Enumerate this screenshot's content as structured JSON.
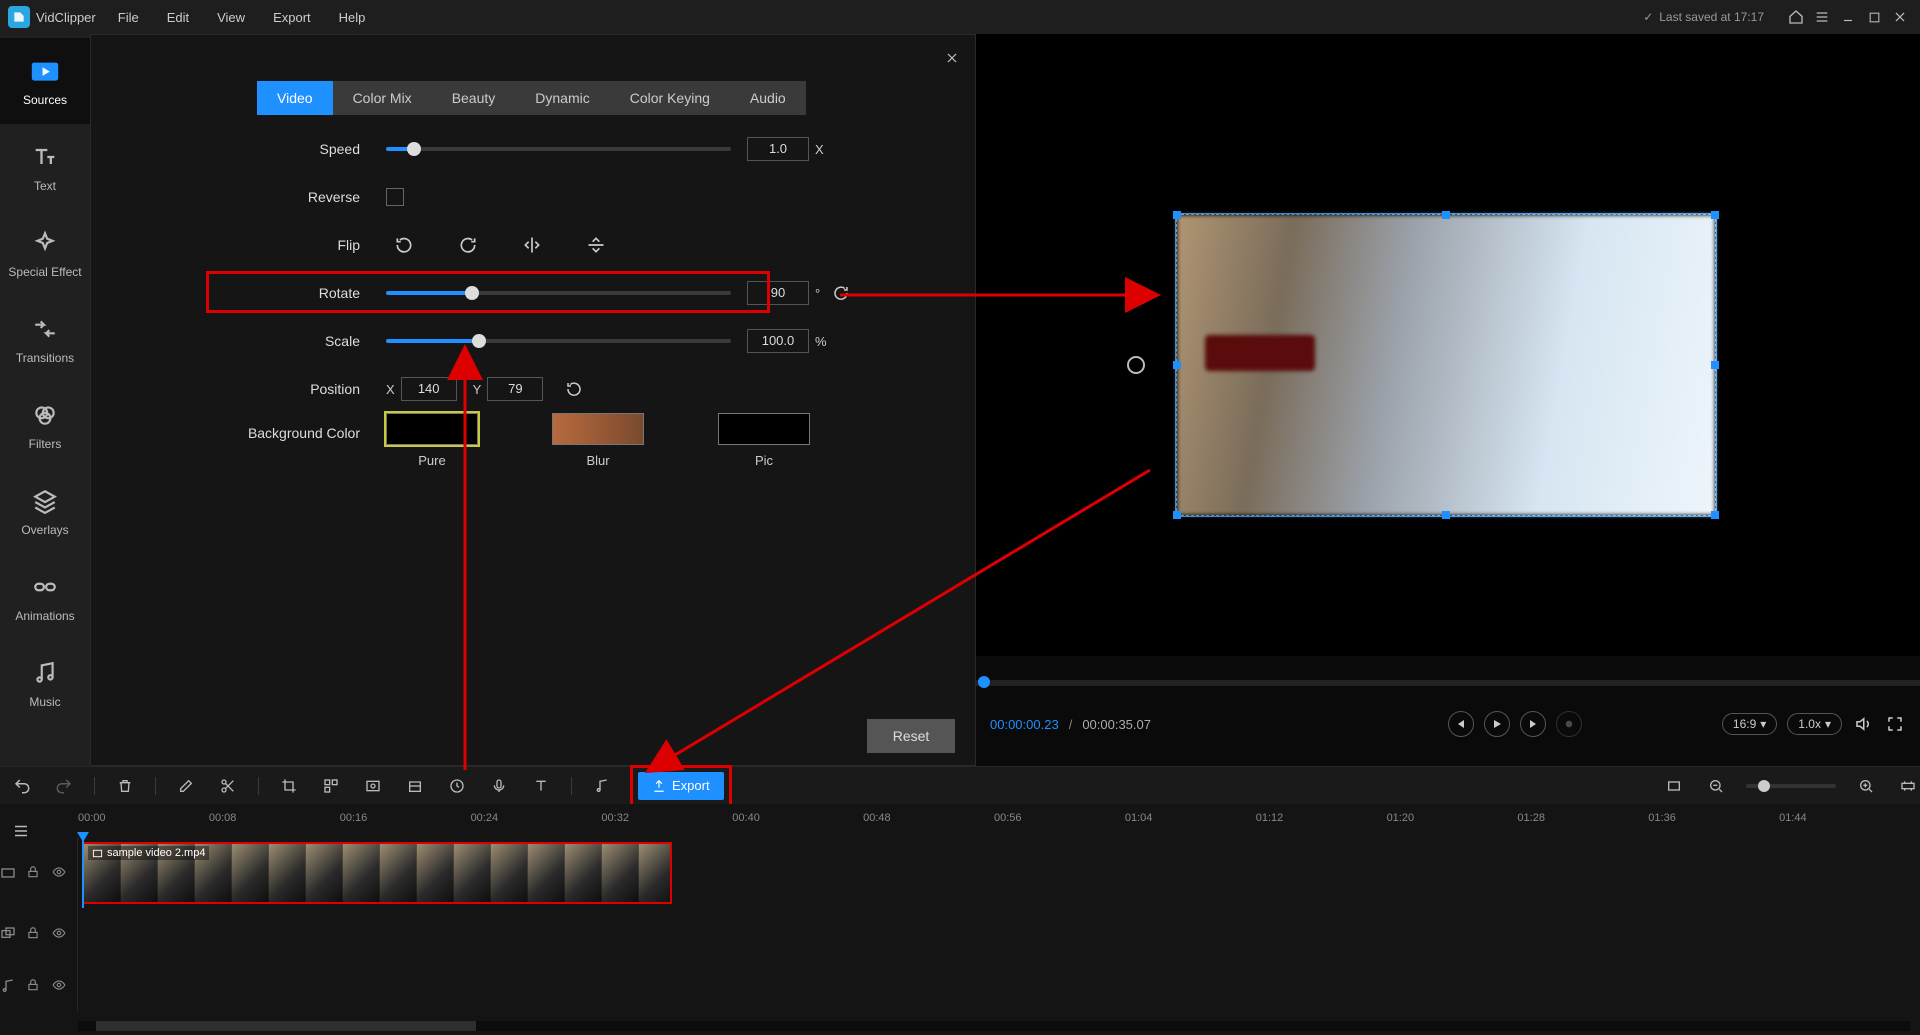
{
  "app": {
    "name": "VidClipper"
  },
  "menubar": [
    "File",
    "Edit",
    "View",
    "Export",
    "Help"
  ],
  "status": {
    "saved_text": "Last saved at 17:17"
  },
  "sidebar": {
    "items": [
      {
        "label": "Sources"
      },
      {
        "label": "Text"
      },
      {
        "label": "Special Effect"
      },
      {
        "label": "Transitions"
      },
      {
        "label": "Filters"
      },
      {
        "label": "Overlays"
      },
      {
        "label": "Animations"
      },
      {
        "label": "Music"
      }
    ]
  },
  "panel": {
    "tabs": [
      "Video",
      "Color Mix",
      "Beauty",
      "Dynamic",
      "Color Keying",
      "Audio"
    ],
    "active_tab": 0,
    "speed": {
      "label": "Speed",
      "value": "1.0",
      "unit": "X",
      "pct": 8
    },
    "reverse": {
      "label": "Reverse",
      "checked": false
    },
    "flip": {
      "label": "Flip"
    },
    "rotate": {
      "label": "Rotate",
      "value": "90",
      "unit": "°",
      "pct": 25
    },
    "scale": {
      "label": "Scale",
      "value": "100.0",
      "unit": "%",
      "pct": 27
    },
    "position": {
      "label": "Position",
      "x_label": "X",
      "y_label": "Y",
      "x": "140",
      "y": "79"
    },
    "bgcolor": {
      "label": "Background Color",
      "options": [
        {
          "label": "Pure",
          "color": "#000000",
          "selected": true
        },
        {
          "label": "Blur",
          "color": "linear-gradient(90deg,#b76a3e,#7a4a2e)",
          "selected": false
        },
        {
          "label": "Pic",
          "color": "#000000",
          "selected": false
        }
      ]
    },
    "reset_label": "Reset"
  },
  "preview": {
    "time_current": "00:00:00.23",
    "time_total": "00:00:35.07",
    "aspect_label": "16:9",
    "speed_label": "1.0x"
  },
  "toolbar": {
    "export_label": "Export"
  },
  "timeline": {
    "clip_filename": "sample video 2.mp4",
    "ruler": [
      "00:00",
      "00:08",
      "00:16",
      "00:24",
      "00:32",
      "00:40",
      "00:48",
      "00:56",
      "01:04",
      "01:12",
      "01:20",
      "01:28",
      "01:36",
      "01:44"
    ]
  },
  "colors": {
    "accent": "#1e90ff",
    "danger": "#d00000"
  }
}
